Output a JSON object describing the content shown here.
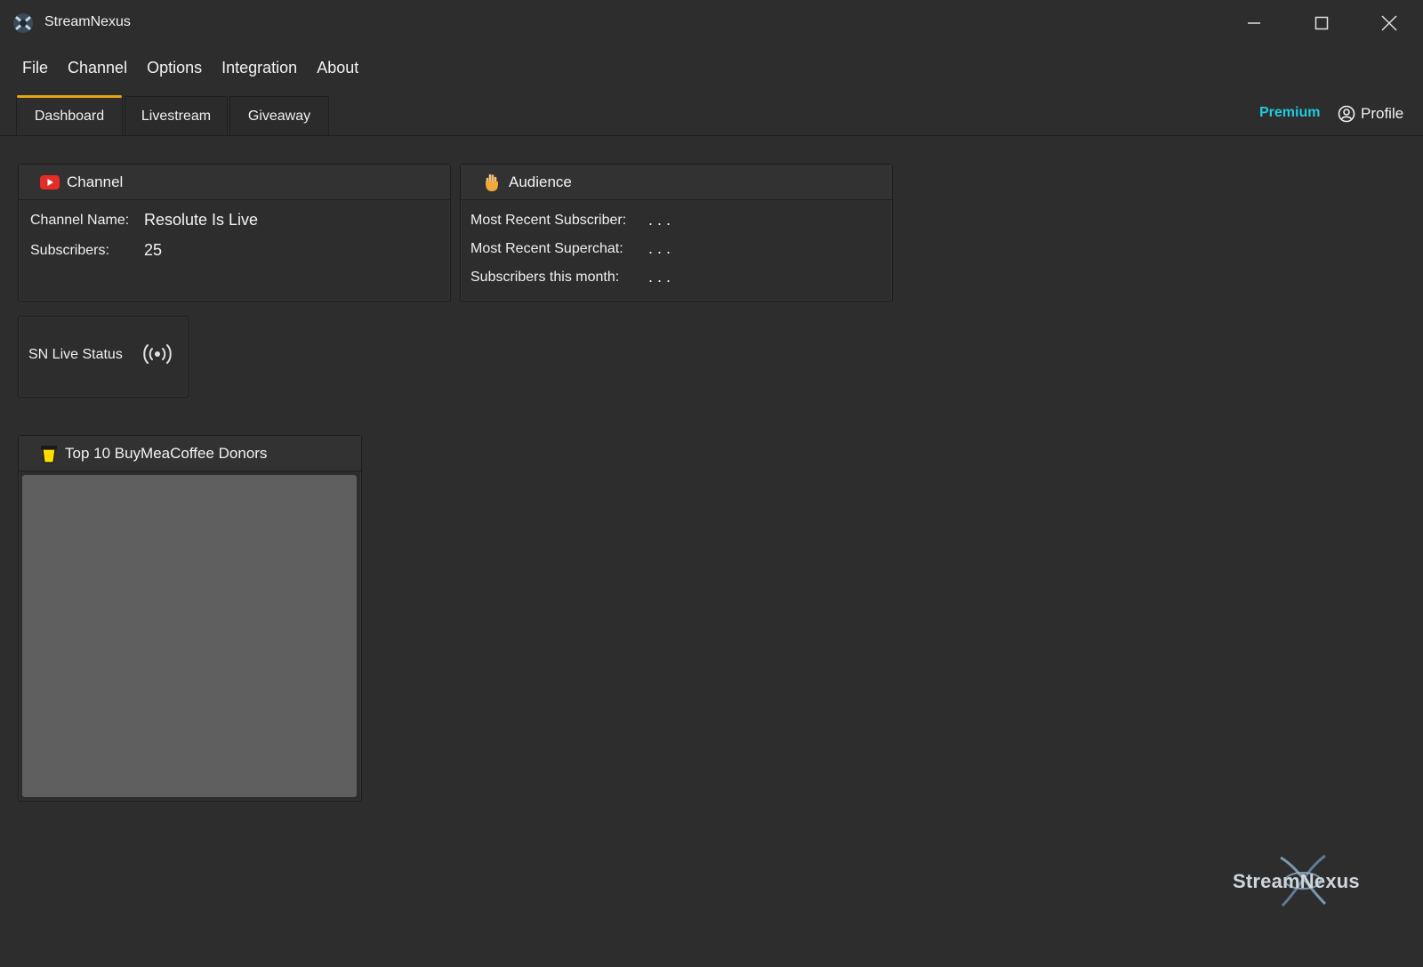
{
  "window": {
    "title": "StreamNexus"
  },
  "menu": {
    "items": [
      "File",
      "Channel",
      "Options",
      "Integration",
      "About"
    ]
  },
  "tabs": [
    {
      "label": "Dashboard",
      "active": true
    },
    {
      "label": "Livestream",
      "active": false
    },
    {
      "label": "Giveaway",
      "active": false
    }
  ],
  "header_right": {
    "premium_label": "Premium",
    "profile_label": "Profile"
  },
  "channel_panel": {
    "title": "Channel",
    "name_label": "Channel Name:",
    "name_value": "Resolute Is Live",
    "subs_label": "Subscribers:",
    "subs_value": "25"
  },
  "audience_panel": {
    "title": "Audience",
    "recent_sub_label": "Most Recent Subscriber:",
    "recent_sub_value": ". . .",
    "recent_superchat_label": "Most Recent Superchat:",
    "recent_superchat_value": ". . .",
    "subs_month_label": "Subscribers this month:",
    "subs_month_value": ". . ."
  },
  "live_panel": {
    "label": "SN Live Status"
  },
  "donors_panel": {
    "title": "Top 10 BuyMeaCoffee Donors"
  },
  "brand": {
    "logo_text": "StreamNexus"
  },
  "colors": {
    "accent_tab": "#e8a215",
    "premium": "#22c9e0",
    "youtube_red": "#e52d27",
    "coffee_yellow": "#ffdd00"
  }
}
